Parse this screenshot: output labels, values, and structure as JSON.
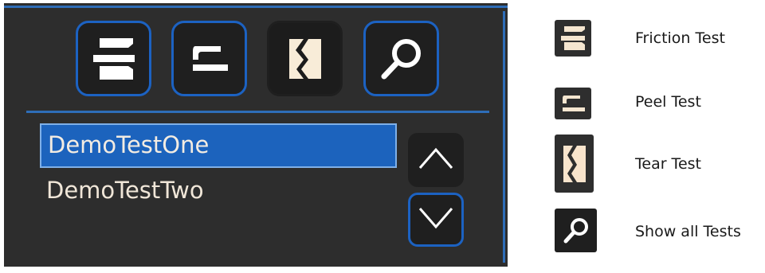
{
  "toolbar": {
    "buttons": [
      {
        "name": "Friction Test",
        "icon": "friction-test-icon",
        "selected": false
      },
      {
        "name": "Peel Test",
        "icon": "peel-test-icon",
        "selected": false
      },
      {
        "name": "Tear Test",
        "icon": "tear-test-icon",
        "selected": true
      },
      {
        "name": "Show all Tests",
        "icon": "search-icon",
        "selected": false
      }
    ]
  },
  "test_list": {
    "items": [
      "DemoTestOne",
      "DemoTestTwo"
    ],
    "selected_index": 0
  },
  "scroll": {
    "up_icon": "chevron-up-icon",
    "down_icon": "chevron-down-icon"
  },
  "legend": {
    "items": [
      {
        "label": "Friction Test",
        "icon": "friction-test-icon"
      },
      {
        "label": "Peel Test",
        "icon": "peel-test-icon"
      },
      {
        "label": "Tear Test",
        "icon": "tear-test-icon"
      },
      {
        "label": "Show all Tests",
        "icon": "search-icon"
      }
    ]
  },
  "colors": {
    "panel_bg": "#2d2d2d",
    "accent_blue": "#1c62c2",
    "selection_blue": "#1c63bd",
    "icon_cream": "#f5e6d0",
    "text_light": "#f0e6d8"
  }
}
